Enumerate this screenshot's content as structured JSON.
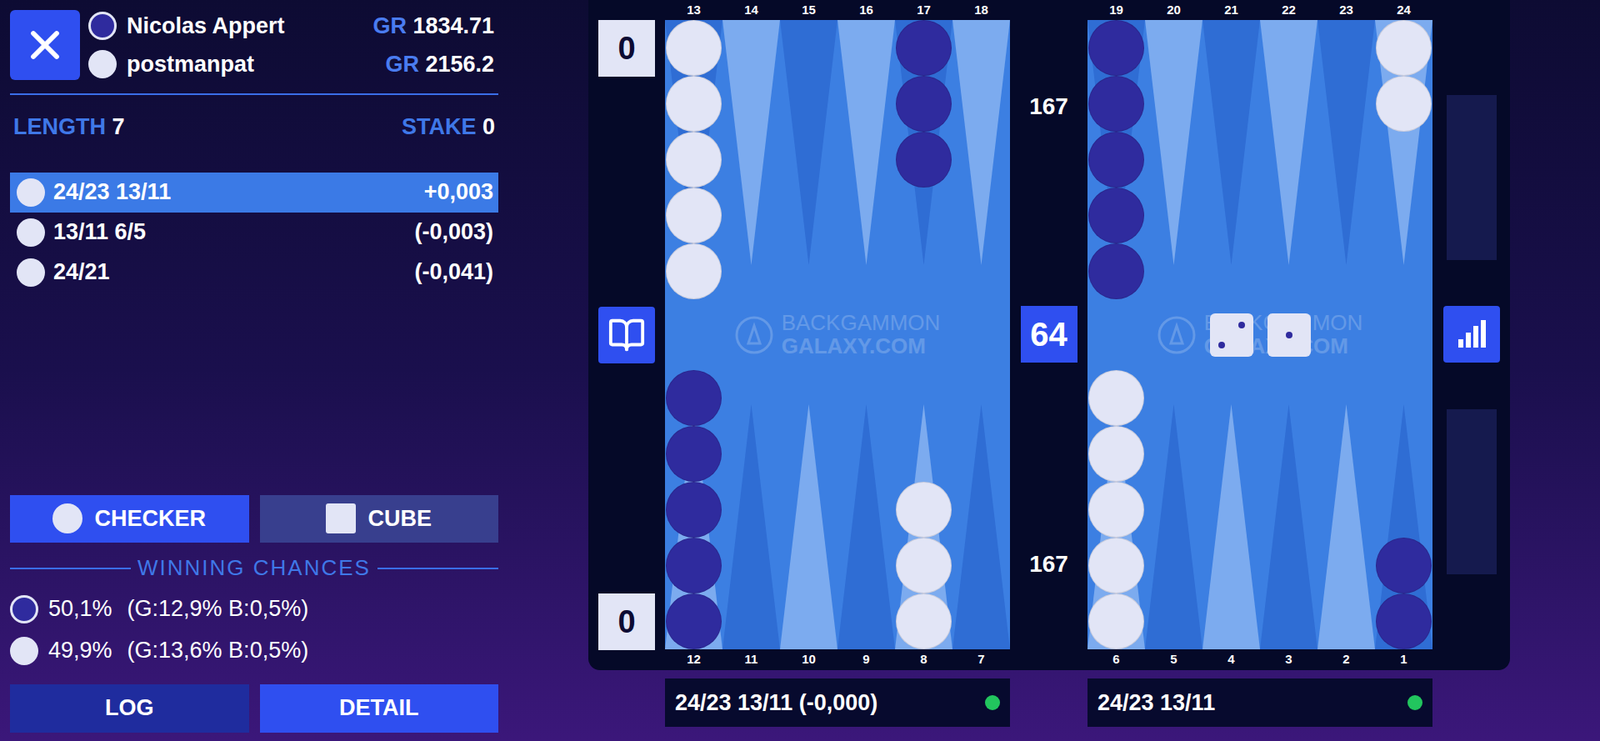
{
  "players": [
    {
      "name": "Nicolas Appert",
      "rating_label": "GR",
      "rating": "1834.71",
      "color": "#2f2b9e"
    },
    {
      "name": "postmanpat",
      "rating_label": "GR",
      "rating": "2156.2",
      "color": "#e2e5f6"
    }
  ],
  "match": {
    "length_label": "LENGTH",
    "length": "7",
    "stake_label": "STAKE",
    "stake": "0"
  },
  "moves": [
    {
      "move": "24/23 13/11",
      "equity": "+0,003",
      "selected": true,
      "color": "#e2e5f6"
    },
    {
      "move": "13/11 6/5",
      "equity": "(-0,003)",
      "selected": false,
      "color": "#e2e5f6"
    },
    {
      "move": "24/21",
      "equity": "(-0,041)",
      "selected": false,
      "color": "#e2e5f6"
    }
  ],
  "mode_tabs": [
    {
      "label": "CHECKER",
      "selected": true,
      "kind": "circle"
    },
    {
      "label": "CUBE",
      "selected": false,
      "kind": "square"
    }
  ],
  "winning_chances": {
    "title": "WINNING CHANCES",
    "rows": [
      {
        "percent": "50,1%",
        "detail": "(G:12,9% B:0,5%)",
        "color": "#2f2b9e"
      },
      {
        "percent": "49,9%",
        "detail": "(G:13,6% B:0,5%)",
        "color": "#e2e5f6"
      }
    ]
  },
  "footer_buttons": [
    {
      "label": "LOG",
      "kind": "dark"
    },
    {
      "label": "DETAIL",
      "kind": "bright"
    }
  ],
  "board": {
    "scores": [
      "0",
      "0"
    ],
    "pips": [
      "167",
      "167"
    ],
    "cube": "64",
    "dice": [
      2,
      1
    ],
    "watermark": [
      "BACKGAMMON",
      "GALAXY.COM"
    ],
    "top_left": [
      {
        "label": "13",
        "checkers": 5,
        "color": "#e2e5f6"
      },
      {
        "label": "14",
        "checkers": 0
      },
      {
        "label": "15",
        "checkers": 0
      },
      {
        "label": "16",
        "checkers": 0
      },
      {
        "label": "17",
        "checkers": 3,
        "color": "#2f2b9e"
      },
      {
        "label": "18",
        "checkers": 0
      }
    ],
    "top_right": [
      {
        "label": "19",
        "checkers": 5,
        "color": "#2f2b9e"
      },
      {
        "label": "20",
        "checkers": 0
      },
      {
        "label": "21",
        "checkers": 0
      },
      {
        "label": "22",
        "checkers": 0
      },
      {
        "label": "23",
        "checkers": 0
      },
      {
        "label": "24",
        "checkers": 2,
        "color": "#e2e5f6"
      }
    ],
    "bottom_left": [
      {
        "label": "12",
        "checkers": 5,
        "color": "#2f2b9e"
      },
      {
        "label": "11",
        "checkers": 0
      },
      {
        "label": "10",
        "checkers": 0
      },
      {
        "label": "9",
        "checkers": 0
      },
      {
        "label": "8",
        "checkers": 3,
        "color": "#e2e5f6"
      },
      {
        "label": "7",
        "checkers": 0
      }
    ],
    "bottom_right": [
      {
        "label": "6",
        "checkers": 5,
        "color": "#e2e5f6"
      },
      {
        "label": "5",
        "checkers": 0
      },
      {
        "label": "4",
        "checkers": 0
      },
      {
        "label": "3",
        "checkers": 0
      },
      {
        "label": "2",
        "checkers": 0
      },
      {
        "label": "1",
        "checkers": 2,
        "color": "#2f2b9e"
      }
    ]
  },
  "status": [
    {
      "text": "24/23 13/11 (-0,000)",
      "ok": true
    },
    {
      "text": "24/23 13/11",
      "ok": true
    }
  ]
}
